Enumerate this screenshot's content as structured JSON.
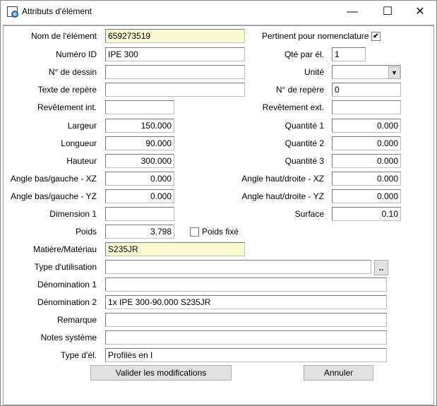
{
  "window": {
    "title": "Attributs d'élément",
    "minimize": "—",
    "maximize": "☐",
    "close": "✕"
  },
  "left": [
    {
      "label": "Nom de l'élément",
      "value": "659273519"
    },
    {
      "label": "Numéro ID",
      "value": "IPE 300"
    },
    {
      "label": "N° de dessin",
      "value": ""
    },
    {
      "label": "Texte de repère",
      "value": ""
    },
    {
      "label": "Revêtement int.",
      "value": ""
    },
    {
      "label": "Largeur",
      "value": "150.000"
    },
    {
      "label": "Longueur",
      "value": "90.000"
    },
    {
      "label": "Hauteur",
      "value": "300.000"
    },
    {
      "label": "Angle bas/gauche - XZ",
      "value": "0.000"
    },
    {
      "label": "Angle bas/gauche - YZ",
      "value": "0.000"
    },
    {
      "label": "Dimension 1",
      "value": ""
    },
    {
      "label": "Poids",
      "value": "3.798"
    },
    {
      "label": "Matière/Matériau",
      "value": "S235JR"
    },
    {
      "label": "Type d'utilisation",
      "value": ""
    },
    {
      "label": "Dénomination 1",
      "value": ""
    },
    {
      "label": "Dénomination 2",
      "value": "1x IPE 300-90.000 S235JR"
    },
    {
      "label": "Remarque",
      "value": ""
    },
    {
      "label": "Notes système",
      "value": ""
    },
    {
      "label": "Type d'él.",
      "value": "Profilés en I"
    }
  ],
  "right": [
    {
      "label": "Pertinent pour nomenclature",
      "checked": true
    },
    {
      "label": "Qté par él.",
      "value": "1"
    },
    {
      "label": "Unité",
      "value": ""
    },
    {
      "label": "N° de repère",
      "value": "0"
    },
    {
      "label": "Revêtement ext.",
      "value": ""
    },
    {
      "label": "Quantité 1",
      "value": "0.000"
    },
    {
      "label": "Quantité 2",
      "value": "0.000"
    },
    {
      "label": "Quantité 3",
      "value": "0.000"
    },
    {
      "label": "Angle haut/droite - XZ",
      "value": "0.000"
    },
    {
      "label": "Angle haut/droite - YZ",
      "value": "0.000"
    },
    {
      "label": "Surface",
      "value": "0.10"
    }
  ],
  "poids_fixe": {
    "label": "Poids fixé",
    "checked": false
  },
  "browse_button": "..",
  "dropdown_arrow": "▼",
  "check_mark": "✔",
  "buttons": {
    "apply": "Valider les modifications",
    "cancel": "Annuler"
  }
}
